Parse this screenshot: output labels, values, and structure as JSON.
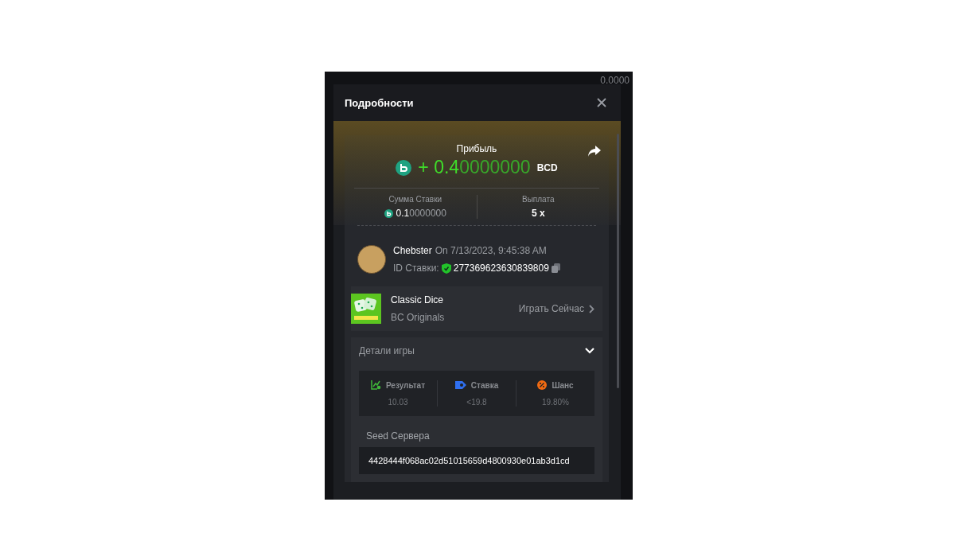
{
  "background": {
    "balance": "0.0000"
  },
  "modal": {
    "title": "Подробности"
  },
  "profit": {
    "label": "Прибыль",
    "sign": "+",
    "amount_main": "0.4",
    "amount_tail": "0000000",
    "currency": "BCD"
  },
  "bet_amount": {
    "label": "Сумма Ставки",
    "value_main": "0.1",
    "value_tail": "0000000"
  },
  "payout": {
    "label": "Выплата",
    "value": "5 x"
  },
  "player": {
    "name": "Chebster",
    "date": "On 7/13/2023, 9:45:38 AM",
    "bet_id_label": "ID Ставки:",
    "bet_id": "277369623630839809",
    "verified": true
  },
  "game": {
    "name": "Classic Dice",
    "provider": "BC Originals",
    "play_link": "Играть Сейчас"
  },
  "details": {
    "title": "Детали игры",
    "expanded": true,
    "stats": [
      {
        "kind": "result",
        "label": "Результат",
        "value": "10.03"
      },
      {
        "kind": "bet",
        "label": "Ставка",
        "value": "<19.8"
      },
      {
        "kind": "chance",
        "label": "Шанс",
        "value": "19.80%"
      }
    ],
    "server_seed_label": "Seed Сервера",
    "server_seed": "4428444f068ac02d51015659d4800930e01ab3d1cd"
  }
}
